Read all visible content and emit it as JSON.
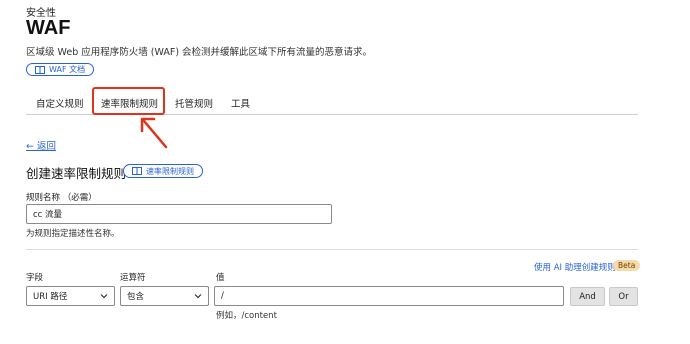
{
  "breadcrumb": "安全性",
  "title": "WAF",
  "description": "区域级 Web 应用程序防火墙 (WAF) 会检测并缓解此区域下所有流量的恶意请求。",
  "docs_button": "WAF 文档",
  "tabs": [
    {
      "label": "自定义规则"
    },
    {
      "label": "速率限制规则"
    },
    {
      "label": "托管规则"
    },
    {
      "label": "工具"
    }
  ],
  "back_link": "← 返回",
  "section_title": "创建速率限制规则",
  "rate_limit_docs_button": "速率限制规则",
  "rule_name": {
    "label": "规则名称 （必需）",
    "value": "cc 流量",
    "help": "为规则指定描述性名称。"
  },
  "ai_builder": {
    "link": "使用 AI 助理创建规则",
    "badge": "Beta"
  },
  "expression": {
    "field_label": "字段",
    "field_value": "URI 路径",
    "operator_label": "运算符",
    "operator_value": "包含",
    "value_label": "值",
    "value_value": "/",
    "value_example": "例如，/content",
    "and_button": "And",
    "or_button": "Or"
  },
  "colors": {
    "accent": "#2a62d9",
    "highlight": "#e0321c"
  }
}
